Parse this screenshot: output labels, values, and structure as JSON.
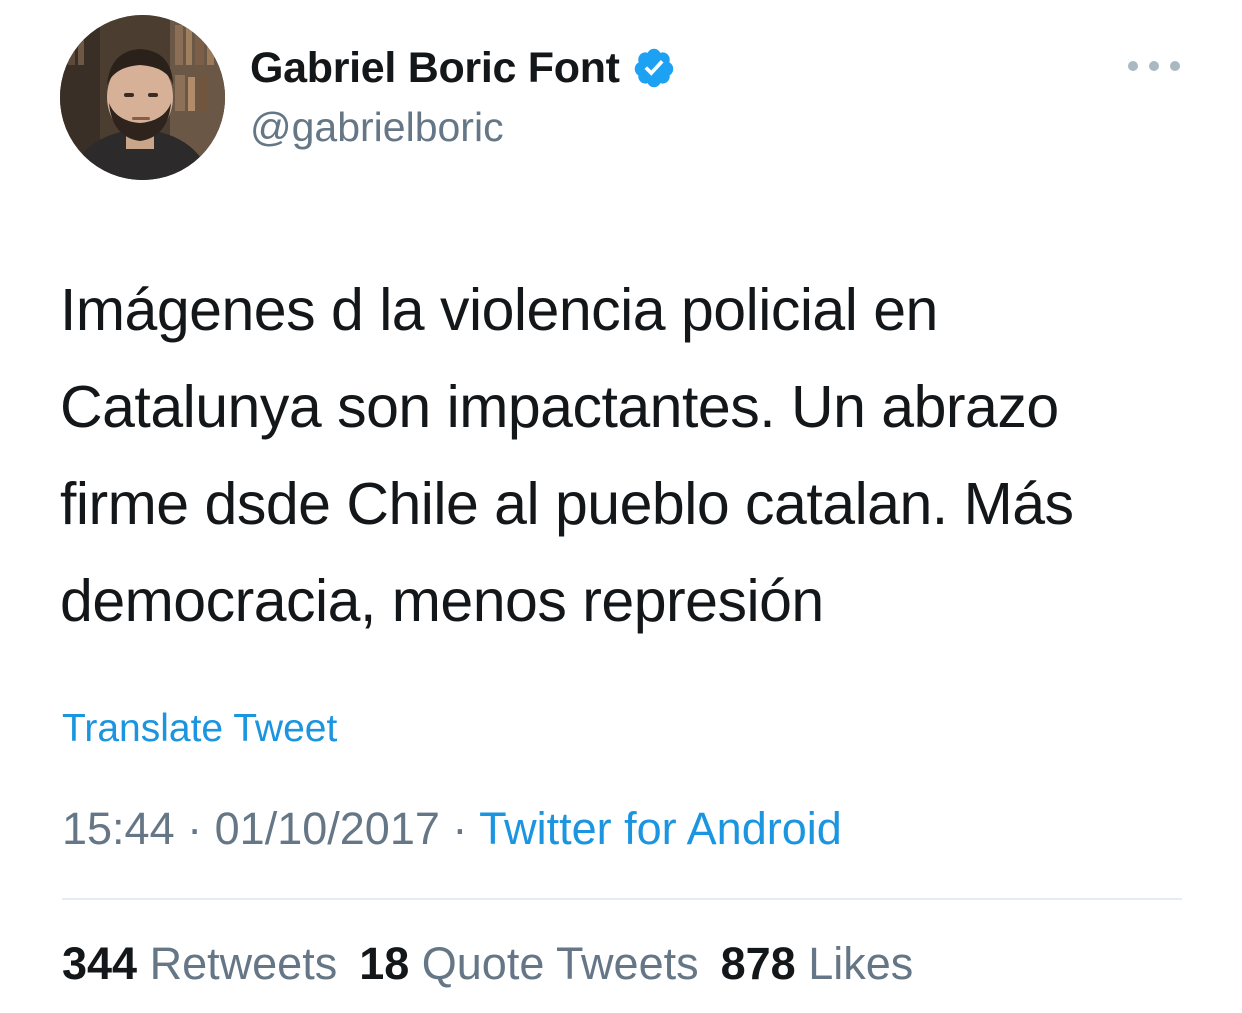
{
  "author": {
    "display_name": "Gabriel Boric Font",
    "handle": "@gabrielboric",
    "verified": true,
    "avatar_icon": "profile-photo"
  },
  "tweet": {
    "text_lines": [
      "Imágenes d la violencia policial en",
      "Catalunya son impactantes. Un abrazo",
      "firme dsde Chile al pueblo catalan. Más",
      "democracia, menos represión"
    ],
    "translate_label": "Translate Tweet",
    "time": "15:44",
    "date": "01/10/2017",
    "separator": "·",
    "source": "Twitter for Android"
  },
  "stats": {
    "retweets_count": "344",
    "retweets_label": "Retweets",
    "quotes_count": "18",
    "quotes_label": "Quote Tweets",
    "likes_count": "878",
    "likes_label": "Likes"
  },
  "colors": {
    "accent": "#1b95e0",
    "secondary_text": "#657786",
    "primary_text": "#14171a",
    "verified_badge": "#1da1f2"
  }
}
